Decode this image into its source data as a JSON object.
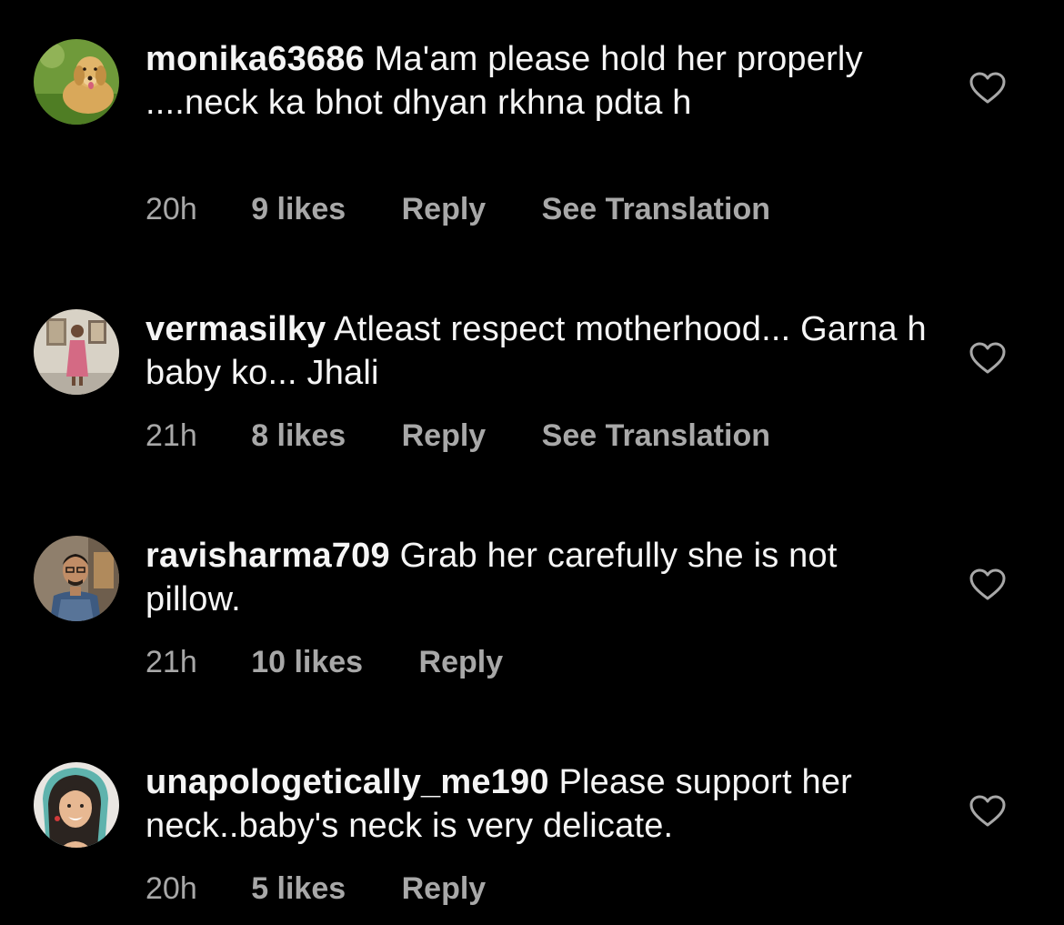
{
  "comments": [
    {
      "username": "monika63686",
      "text": "Ma'am please hold her properly ....neck ka bhot dhyan rkhna pdta h",
      "time": "20h",
      "likes": "9 likes",
      "reply": "Reply",
      "translate": "See Translation",
      "avatar_icon": "dog-avatar",
      "liked": false
    },
    {
      "username": "vermasilky",
      "text": "Atleast respect motherhood... Garna h baby ko... Jhali",
      "time": "21h",
      "likes": "8 likes",
      "reply": "Reply",
      "translate": "See Translation",
      "avatar_icon": "woman-portrait-avatar",
      "liked": false
    },
    {
      "username": "ravisharma709",
      "text": "Grab her carefully she is not pillow.",
      "time": "21h",
      "likes": "10 likes",
      "reply": "Reply",
      "translate": "",
      "avatar_icon": "man-portrait-avatar",
      "liked": false
    },
    {
      "username": "unapologetically_me190",
      "text": "Please support her neck..baby's neck is very delicate.",
      "time": "20h",
      "likes": "5 likes",
      "reply": "Reply",
      "translate": "",
      "avatar_icon": "woman-selfie-avatar",
      "liked": false
    }
  ],
  "colors": {
    "background": "#000000",
    "primary_text": "#f5f5f5",
    "secondary_text": "#a8a8a8"
  }
}
